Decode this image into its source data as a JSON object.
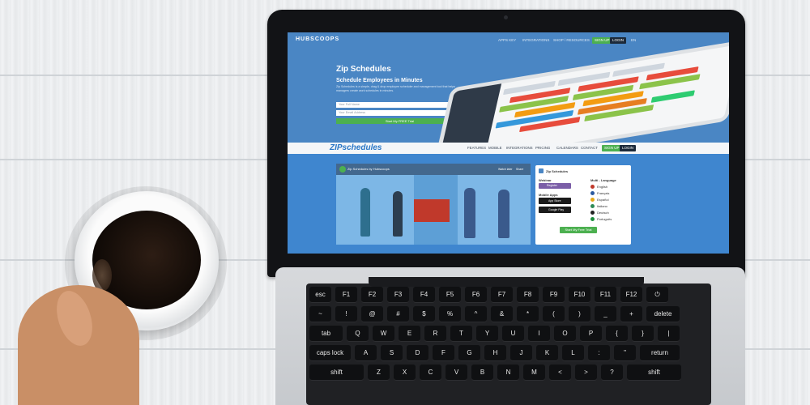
{
  "site": {
    "brand": "HUBSCOOPS",
    "nav_links": [
      "APPS KEY",
      "INTEGRATIONS",
      "SHOP / RESOURCES"
    ],
    "signup": "SIGN UP",
    "login": "LOGIN",
    "lang": "EN"
  },
  "hero": {
    "title": "Zip Schedules",
    "subtitle": "Schedule Employees in Minutes",
    "description": "Zip Schedules is a simple, drag & drop employee scheduler and management tool that helps managers create work schedules in minutes.",
    "input1_placeholder": "Your Full Name",
    "input2_placeholder": "Your Email Address",
    "cta": "Start My FREE Trial"
  },
  "subnav": {
    "logo": "ZIPschedules",
    "links": [
      "FEATURES",
      "MOBILE",
      "INTEGRATIONS",
      "PRICING",
      "CALENDARS",
      "CONTACT"
    ],
    "signup": "SIGN UP",
    "login": "LOGIN"
  },
  "video": {
    "title": "Zip Schedules by Hubscoops",
    "actions": [
      "Watch later",
      "Share"
    ]
  },
  "panel": {
    "title": "Zip Schedules",
    "webinar": "Webinar",
    "register": "Register",
    "mobile_apps": "Mobile Apps",
    "app_store": "App Store",
    "google_play": "Google Play",
    "multi_language": "Multi - Language",
    "languages": [
      "English",
      "Français",
      "Español",
      "Italiano",
      "Deutsch",
      "Português"
    ],
    "cta": "Start My Free Trial"
  },
  "keyboard": {
    "row1": [
      "esc",
      "F1",
      "F2",
      "F3",
      "F4",
      "F5",
      "F6",
      "F7",
      "F8",
      "F9",
      "F10",
      "F11",
      "F12",
      "⏻"
    ],
    "row2": [
      "~",
      "!",
      "@",
      "#",
      "$",
      "%",
      "^",
      "&",
      "*",
      "(",
      ")",
      "_",
      "+",
      "delete"
    ],
    "row3": [
      "tab",
      "Q",
      "W",
      "E",
      "R",
      "T",
      "Y",
      "U",
      "I",
      "O",
      "P",
      "{",
      "}",
      "|"
    ],
    "row4": [
      "caps lock",
      "A",
      "S",
      "D",
      "F",
      "G",
      "H",
      "J",
      "K",
      "L",
      ":",
      "\"",
      "return"
    ],
    "row5": [
      "shift",
      "Z",
      "X",
      "C",
      "V",
      "B",
      "N",
      "M",
      "<",
      ">",
      "?",
      "shift"
    ]
  },
  "colors": {
    "screen_bg": "#4a86c4",
    "accent_green": "#4cb050",
    "lower_bg": "#3f86cf"
  }
}
